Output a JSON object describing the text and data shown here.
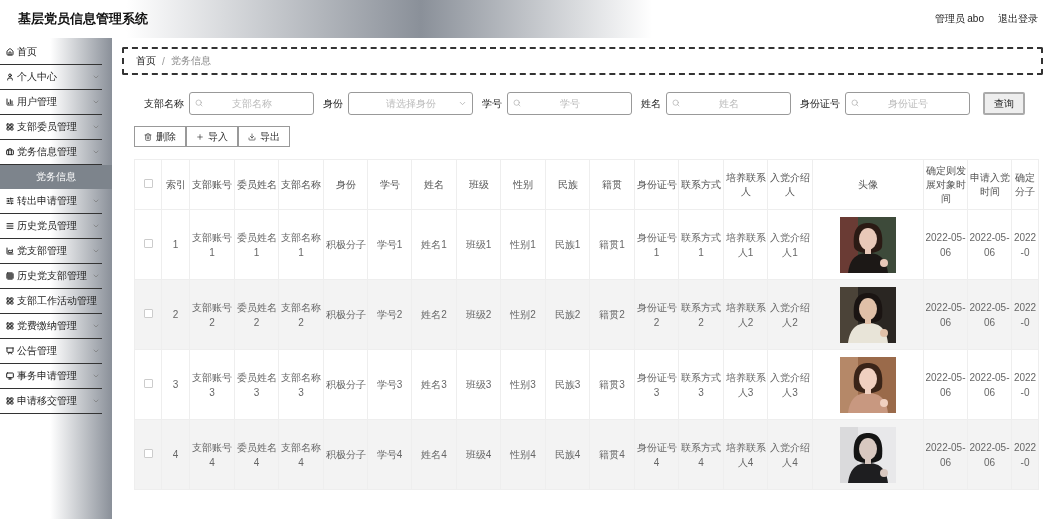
{
  "header": {
    "title": "基层党员信息管理系统",
    "user": "管理员 abo",
    "logout": "退出登录"
  },
  "sidebar": {
    "items": [
      {
        "label": "首页",
        "kind": "link"
      },
      {
        "label": "个人中心",
        "kind": "menu"
      },
      {
        "label": "用户管理",
        "kind": "menu"
      },
      {
        "label": "支部委员管理",
        "kind": "menu"
      },
      {
        "label": "党务信息管理",
        "kind": "menu",
        "children": [
          {
            "label": "党务信息",
            "selected": true
          }
        ]
      },
      {
        "label": "转出申请管理",
        "kind": "menu"
      },
      {
        "label": "历史党员管理",
        "kind": "menu"
      },
      {
        "label": "党支部管理",
        "kind": "menu"
      },
      {
        "label": "历史党支部管理",
        "kind": "menu"
      },
      {
        "label": "支部工作活动管理",
        "kind": "menu"
      },
      {
        "label": "党费缴纳管理",
        "kind": "menu"
      },
      {
        "label": "公告管理",
        "kind": "menu"
      },
      {
        "label": "事务申请管理",
        "kind": "menu"
      },
      {
        "label": "申请移交管理",
        "kind": "menu"
      }
    ]
  },
  "breadcrumb": {
    "items": [
      "首页",
      "党务信息"
    ],
    "separator": "/"
  },
  "search": {
    "fields": [
      {
        "label": "支部名称",
        "placeholder": "支部名称",
        "kind": "input"
      },
      {
        "label": "身份",
        "placeholder": "请选择身份",
        "kind": "select"
      },
      {
        "label": "学号",
        "placeholder": "学号",
        "kind": "input"
      },
      {
        "label": "姓名",
        "placeholder": "姓名",
        "kind": "input"
      },
      {
        "label": "身份证号",
        "placeholder": "身份证号",
        "kind": "input"
      }
    ],
    "button": "查询"
  },
  "actions": [
    {
      "label": "删除"
    },
    {
      "label": "导入"
    },
    {
      "label": "导出"
    }
  ],
  "table": {
    "header_checked": false,
    "columns": [
      "索引",
      "支部账号",
      "委员姓名",
      "支部名称",
      "身份",
      "学号",
      "姓名",
      "班级",
      "性别",
      "民族",
      "籍贯",
      "身份证号",
      "联系方式",
      "培养联系人",
      "入党介绍人",
      "头像",
      "确定则发展对象时间",
      "申请入党时间",
      "确定分子"
    ],
    "rows": [
      {
        "checked": false,
        "cells": [
          "1",
          "支部账号1",
          "委员姓名1",
          "支部名称1",
          "积极分子",
          "学号1",
          "姓名1",
          "班级1",
          "性别1",
          "民族1",
          "籍贯1",
          "身份证号1",
          "联系方式1",
          "培养联系人1",
          "入党介绍人1",
          {
            "kind": "picture"
          },
          "2022-05-06",
          "2022-05-06",
          "2022-0"
        ]
      },
      {
        "checked": false,
        "cells": [
          "2",
          "支部账号2",
          "委员姓名2",
          "支部名称2",
          "积极分子",
          "学号2",
          "姓名2",
          "班级2",
          "性别2",
          "民族2",
          "籍贯2",
          "身份证号2",
          "联系方式2",
          "培养联系人2",
          "入党介绍人2",
          {
            "kind": "picture"
          },
          "2022-05-06",
          "2022-05-06",
          "2022-0"
        ]
      },
      {
        "checked": false,
        "cells": [
          "3",
          "支部账号3",
          "委员姓名3",
          "支部名称3",
          "积极分子",
          "学号3",
          "姓名3",
          "班级3",
          "性别3",
          "民族3",
          "籍贯3",
          "身份证号3",
          "联系方式3",
          "培养联系人3",
          "入党介绍人3",
          {
            "kind": "picture"
          },
          "2022-05-06",
          "2022-05-06",
          "2022-0"
        ]
      },
      {
        "checked": false,
        "cells": [
          "4",
          "支部账号4",
          "委员姓名4",
          "支部名称4",
          "积极分子",
          "学号4",
          "姓名4",
          "班级4",
          "性别4",
          "民族4",
          "籍贯4",
          "身份证号4",
          "联系方式4",
          "培养联系人4",
          "入党介绍人4",
          {
            "kind": "picture"
          },
          "2022-05-06",
          "2022-05-06",
          "2022-0"
        ]
      }
    ]
  }
}
